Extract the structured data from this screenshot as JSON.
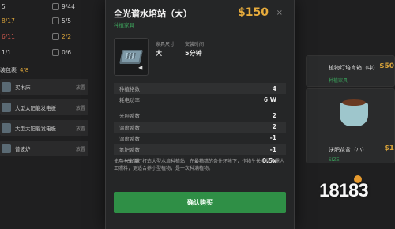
{
  "background": {
    "stats": [
      {
        "id": "s1",
        "value": "5",
        "tone": "normal"
      },
      {
        "id": "s2",
        "value": "9/44",
        "tone": "normal"
      },
      {
        "id": "s3",
        "value": "8/17",
        "tone": "warn"
      },
      {
        "id": "s4",
        "value": "5/5",
        "tone": "normal"
      },
      {
        "id": "s5",
        "value": "6/11",
        "tone": "neg"
      },
      {
        "id": "s6",
        "value": "2/2",
        "tone": "warn"
      },
      {
        "id": "s7",
        "value": "1/1",
        "tone": "normal"
      },
      {
        "id": "s8",
        "value": "0/6",
        "tone": "normal"
      }
    ],
    "package_header": {
      "label": "装包裹",
      "count": "4/8"
    },
    "package_items": [
      {
        "name": "买木床",
        "action": "放置"
      },
      {
        "name": "大型太阳能发电板",
        "action": "放置"
      },
      {
        "name": "大型太阳能发电板",
        "action": "放置"
      },
      {
        "name": "普波炉",
        "action": "放置"
      }
    ],
    "cards": [
      {
        "name": "植物灯培育箱（中）",
        "price": "$50",
        "tag": "种植家具"
      },
      {
        "name": "沃肥花盆（小）",
        "price": "$1",
        "tag": "SIZE"
      }
    ]
  },
  "modal": {
    "title": "全光谱水培站（大）",
    "category": "种植家具",
    "price": "$150",
    "close": "×",
    "meta": [
      {
        "label": "家具尺寸",
        "value": "大"
      },
      {
        "label": "安装时间",
        "value": "5分钟"
      }
    ],
    "attributes_a": [
      {
        "key": "种植格数",
        "value": "4"
      },
      {
        "key": "耗电功率",
        "value": "6 W"
      }
    ],
    "attributes_b": [
      {
        "key": "光照系数",
        "value": "2"
      },
      {
        "key": "温度系数",
        "value": "2"
      },
      {
        "key": "湿度系数",
        "value": "-1"
      },
      {
        "key": "氮肥系数",
        "value": "-1"
      },
      {
        "key": "生长加速",
        "value": "0.5x"
      }
    ],
    "description": "使用全光谱灯打造大型水培种植站，在最糟糕的条件环境下，作物生长全程无需人工照料，更适合养小型植物，是一次种满植物。",
    "buy_label": "确认购买"
  },
  "watermark": "18183",
  "colors": {
    "accent_green": "#2f8f46",
    "price_gold": "#e6ab3c",
    "tag_green": "#3ea45d"
  }
}
